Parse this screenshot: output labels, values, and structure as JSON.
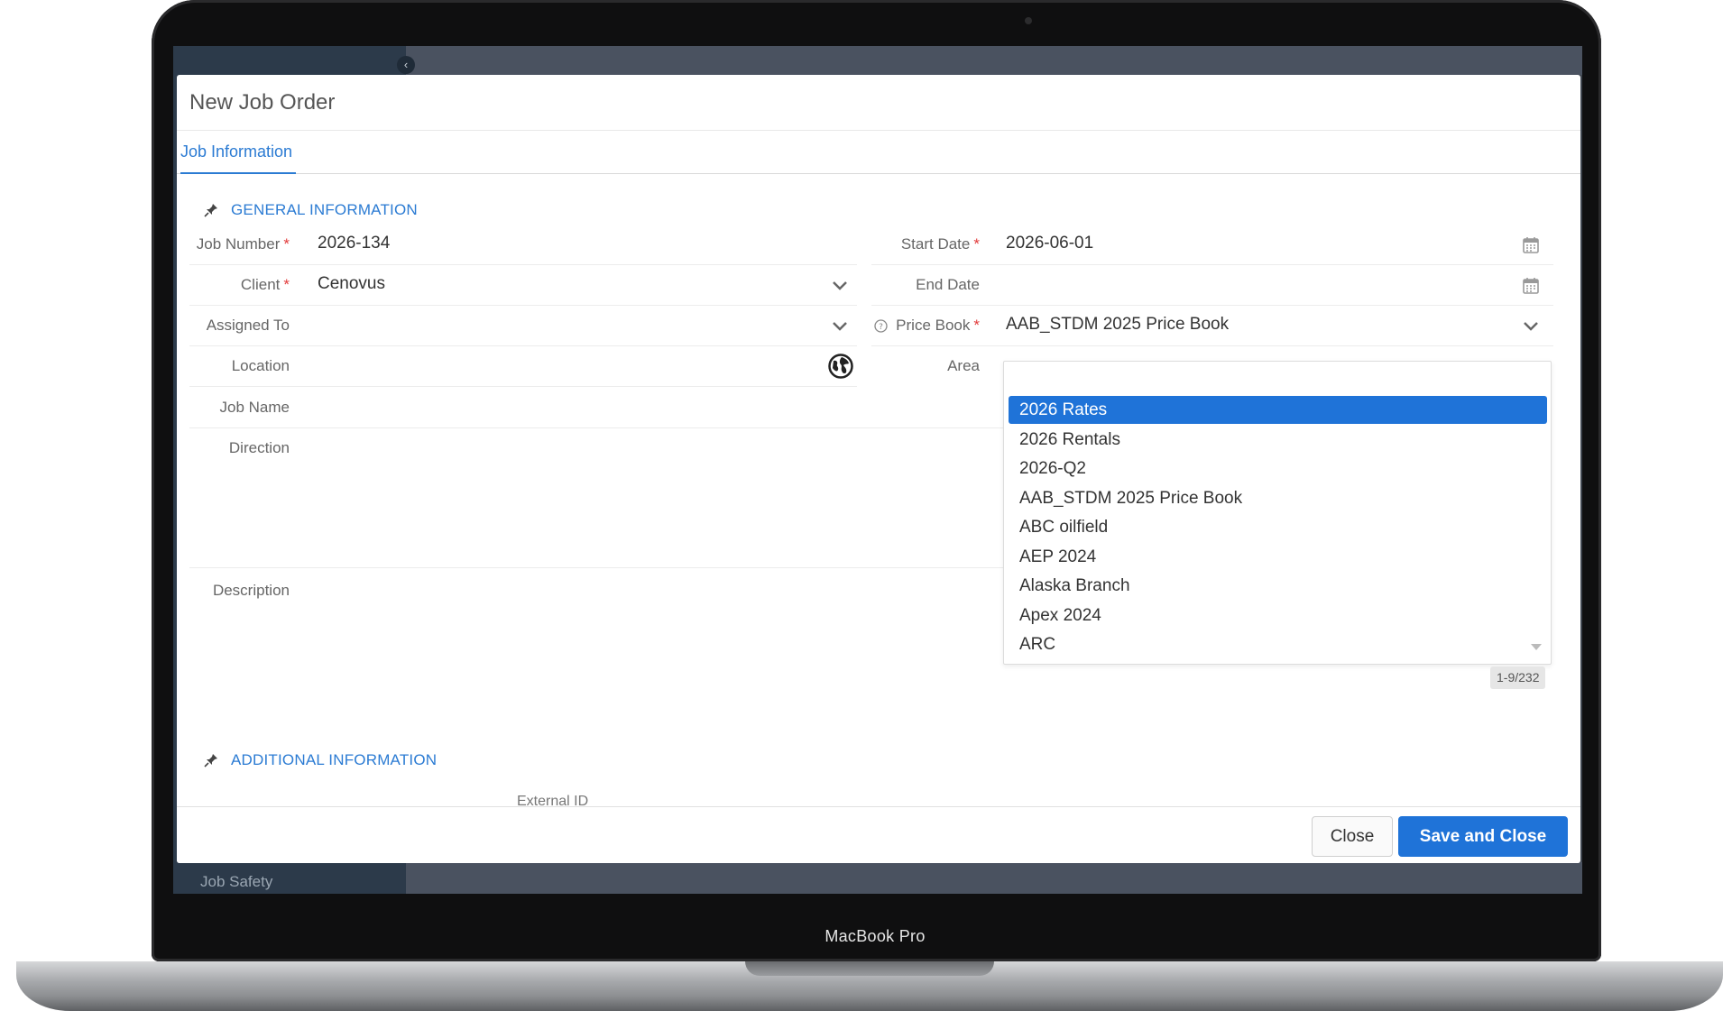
{
  "device_label": "MacBook Pro",
  "background": {
    "sidebar_item": "Job Safety"
  },
  "modal": {
    "title": "New Job Order",
    "tabs": [
      {
        "label": "Job Information"
      }
    ],
    "sections": {
      "general": "GENERAL INFORMATION",
      "additional": "ADDITIONAL INFORMATION"
    },
    "fields": {
      "job_number": {
        "label": "Job Number",
        "value": "2026-134",
        "required": "*"
      },
      "client": {
        "label": "Client",
        "value": "Cenovus",
        "required": "*"
      },
      "assigned_to": {
        "label": "Assigned To",
        "value": ""
      },
      "location": {
        "label": "Location",
        "value": ""
      },
      "job_name": {
        "label": "Job Name",
        "value": ""
      },
      "direction": {
        "label": "Direction",
        "value": ""
      },
      "description": {
        "label": "Description",
        "value": ""
      },
      "start_date": {
        "label": "Start Date",
        "value": "2026-06-01",
        "required": "*"
      },
      "end_date": {
        "label": "End Date",
        "value": ""
      },
      "price_book": {
        "label": "Price Book",
        "value": "AAB_STDM 2025 Price Book",
        "required": "*"
      },
      "area": {
        "label": "Area",
        "value": ""
      },
      "external_id": {
        "label": "External ID"
      }
    },
    "price_book_dropdown": {
      "search_value": "",
      "options": [
        "2026 Rates",
        "2026 Rentals",
        "2026-Q2",
        "AAB_STDM 2025 Price Book",
        "ABC oilfield",
        "AEP 2024",
        "Alaska Branch",
        "Apex 2024",
        "ARC"
      ],
      "selected_index": 0,
      "pager": "1-9/232"
    },
    "footer": {
      "close_label": "Close",
      "save_label": "Save and Close"
    }
  },
  "colors": {
    "accent": "#1f73d8",
    "link": "#2b7bd3",
    "required": "#e23b3b"
  }
}
